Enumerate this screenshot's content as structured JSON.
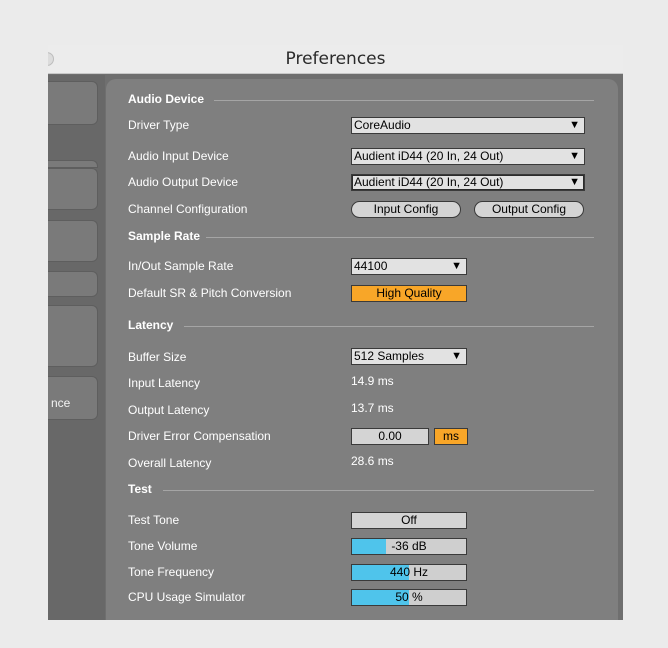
{
  "window": {
    "title": "Preferences"
  },
  "sidebar": {
    "visible_tab_label": "nce"
  },
  "audio_device": {
    "heading": "Audio Device",
    "driver_type": {
      "label": "Driver Type",
      "value": "CoreAudio"
    },
    "input_device": {
      "label": "Audio Input Device",
      "value": "Audient iD44 (20 In, 24 Out)"
    },
    "output_device": {
      "label": "Audio Output Device",
      "value": "Audient iD44 (20 In, 24 Out)"
    },
    "channel_config": {
      "label": "Channel Configuration",
      "input_button": "Input Config",
      "output_button": "Output Config"
    }
  },
  "sample_rate": {
    "heading": "Sample Rate",
    "in_out": {
      "label": "In/Out Sample Rate",
      "value": "44100"
    },
    "conversion": {
      "label": "Default SR & Pitch Conversion",
      "value": "High Quality"
    }
  },
  "latency": {
    "heading": "Latency",
    "buffer_size": {
      "label": "Buffer Size",
      "value": "512 Samples"
    },
    "input_latency": {
      "label": "Input Latency",
      "value": "14.9 ms"
    },
    "output_latency": {
      "label": "Output Latency",
      "value": "13.7 ms"
    },
    "driver_error": {
      "label": "Driver Error Compensation",
      "value": "0.00",
      "unit": "ms"
    },
    "overall_latency": {
      "label": "Overall Latency",
      "value": "28.6 ms"
    }
  },
  "test": {
    "heading": "Test",
    "test_tone": {
      "label": "Test Tone",
      "value": "Off"
    },
    "tone_volume": {
      "label": "Tone Volume",
      "value": "-36",
      "unit": "dB",
      "level": 0.3
    },
    "tone_frequency": {
      "label": "Tone Frequency",
      "value": "440",
      "unit": "Hz",
      "level": 0.5
    },
    "cpu_usage": {
      "label": "CPU Usage Simulator",
      "value": "50",
      "unit": "%",
      "level": 0.5
    }
  },
  "colors": {
    "accent_orange": "#f8a628",
    "slider_blue": "#4fc4eb",
    "panel_gray": "#7f7f7f"
  },
  "icons": {
    "dropdown_arrow": "▼"
  }
}
